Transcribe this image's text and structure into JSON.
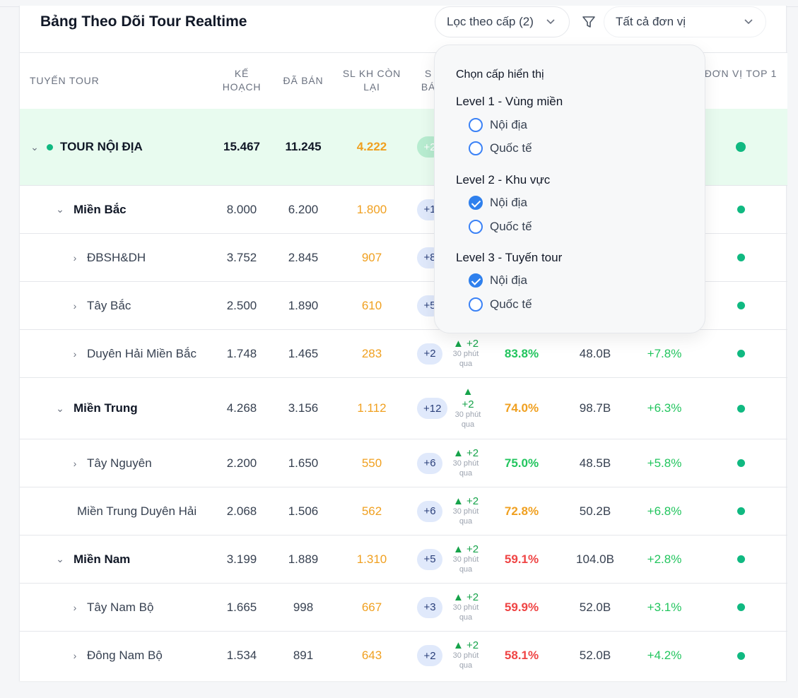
{
  "header": {
    "title": "Bảng Theo Dõi Tour Realtime",
    "filter_label": "Lọc theo cấp (2)",
    "unit_select_value": "Tất cả đơn vị"
  },
  "columns": {
    "route": "TUYẾN TOUR",
    "plan": "KẾ HOẠCH",
    "sold": "ĐÃ BÁN",
    "remaining": "SL KH CÒN LẠI",
    "col5_partial": "S BÁ",
    "top_unit": "ĐƠN VỊ TOP 1"
  },
  "popup": {
    "title": "Chọn cấp hiển thị",
    "levels": [
      {
        "label": "Level 1 - Vùng miền",
        "options": [
          {
            "label": "Nội địa",
            "checked": false
          },
          {
            "label": "Quốc tế",
            "checked": false
          }
        ]
      },
      {
        "label": "Level 2 - Khu vực",
        "options": [
          {
            "label": "Nội địa",
            "checked": true
          },
          {
            "label": "Quốc tế",
            "checked": false
          }
        ]
      },
      {
        "label": "Level 3 - Tuyến tour",
        "options": [
          {
            "label": "Nội địa",
            "checked": true
          },
          {
            "label": "Quốc tế",
            "checked": false
          }
        ]
      }
    ]
  },
  "rows": [
    {
      "name": "TOUR NỘI ĐỊA",
      "plan": "15.467",
      "sold": "11.245",
      "remaining": "4.222",
      "pill": "+2",
      "trend": "",
      "trend_time": "",
      "pct": "",
      "revenue": "",
      "growth": ""
    },
    {
      "name": "Miền Bắc",
      "plan": "8.000",
      "sold": "6.200",
      "remaining": "1.800",
      "pill": "+1",
      "trend": "",
      "trend_time": "",
      "pct": "",
      "revenue": "",
      "growth": ""
    },
    {
      "name": "ĐBSH&DH",
      "plan": "3.752",
      "sold": "2.845",
      "remaining": "907",
      "pill": "+8",
      "trend": "",
      "trend_time": "",
      "pct": "",
      "revenue": "",
      "growth": ""
    },
    {
      "name": "Tây Bắc",
      "plan": "2.500",
      "sold": "1.890",
      "remaining": "610",
      "pill": "+5",
      "trend": "",
      "trend_time": "",
      "pct": "",
      "revenue": "",
      "growth": ""
    },
    {
      "name": "Duyên Hải Miền Bắc",
      "plan": "1.748",
      "sold": "1.465",
      "remaining": "283",
      "pill": "+2",
      "trend": "▲ +2",
      "trend_time": "30 phút qua",
      "pct": "83.8%",
      "revenue": "48.0B",
      "growth": "+7.8%"
    },
    {
      "name": "Miền Trung",
      "plan": "4.268",
      "sold": "3.156",
      "remaining": "1.112",
      "pill": "+12",
      "trend_arrow": "▲",
      "trend": "+2",
      "trend_time": "30 phút qua",
      "pct": "74.0%",
      "revenue": "98.7B",
      "growth": "+6.3%"
    },
    {
      "name": "Tây Nguyên",
      "plan": "2.200",
      "sold": "1.650",
      "remaining": "550",
      "pill": "+6",
      "trend": "▲ +2",
      "trend_time": "30 phút qua",
      "pct": "75.0%",
      "revenue": "48.5B",
      "growth": "+5.8%"
    },
    {
      "name": "Miền Trung Duyên Hải",
      "plan": "2.068",
      "sold": "1.506",
      "remaining": "562",
      "pill": "+6",
      "trend": "▲ +2",
      "trend_time": "30 phút qua",
      "pct": "72.8%",
      "revenue": "50.2B",
      "growth": "+6.8%"
    },
    {
      "name": "Miền Nam",
      "plan": "3.199",
      "sold": "1.889",
      "remaining": "1.310",
      "pill": "+5",
      "trend": "▲ +2",
      "trend_time": "30 phút qua",
      "pct": "59.1%",
      "revenue": "104.0B",
      "growth": "+2.8%"
    },
    {
      "name": "Tây Nam Bộ",
      "plan": "1.665",
      "sold": "998",
      "remaining": "667",
      "pill": "+3",
      "trend": "▲ +2",
      "trend_time": "30 phút qua",
      "pct": "59.9%",
      "revenue": "52.0B",
      "growth": "+3.1%"
    },
    {
      "name": "Đông Nam Bộ",
      "plan": "1.534",
      "sold": "891",
      "remaining": "643",
      "pill": "+2",
      "trend": "▲ +2",
      "trend_time": "30 phút qua",
      "pct": "58.1%",
      "revenue": "52.0B",
      "growth": "+4.2%"
    }
  ],
  "colors": {
    "accent": "#2f80ed",
    "green": "#10b981",
    "orange": "#f0a020",
    "red": "#ef4444",
    "top_row_bg": "#e8fbef"
  }
}
